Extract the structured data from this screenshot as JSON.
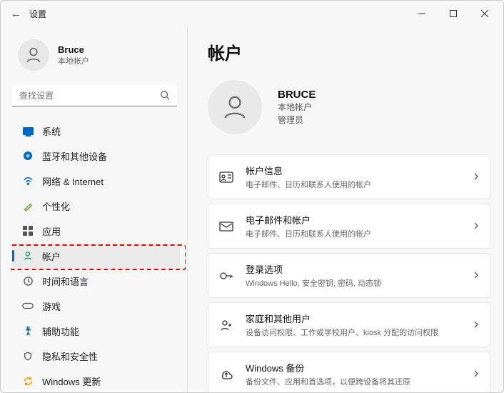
{
  "app_title": "设置",
  "user": {
    "name": "Bruce",
    "type": "本地帐户"
  },
  "search": {
    "placeholder": "查找设置"
  },
  "sidebar": {
    "items": [
      {
        "label": "系统"
      },
      {
        "label": "蓝牙和其他设备"
      },
      {
        "label": "网络 & Internet"
      },
      {
        "label": "个性化"
      },
      {
        "label": "应用"
      },
      {
        "label": "帐户"
      },
      {
        "label": "时间和语言"
      },
      {
        "label": "游戏"
      },
      {
        "label": "辅助功能"
      },
      {
        "label": "隐私和安全性"
      },
      {
        "label": "Windows 更新"
      }
    ],
    "selected_index": 5
  },
  "main": {
    "heading": "帐户",
    "account": {
      "display_name": "BRUCE",
      "type": "本地帐户",
      "role": "管理员"
    },
    "cards": [
      {
        "title": "帐户信息",
        "desc": "电子邮件、日历和联系人使用的帐户"
      },
      {
        "title": "电子邮件和帐户",
        "desc": "电子邮件、日历和联系人使用的帐户"
      },
      {
        "title": "登录选项",
        "desc": "Windows Hello, 安全密钥, 密码, 动态锁"
      },
      {
        "title": "家庭和其他用户",
        "desc": "设备访问权限、工作或学校用户、kiosk 分配的访问权限"
      },
      {
        "title": "Windows 备份",
        "desc": "备份文件、应用和首选项，以便跨设备将其还原"
      }
    ]
  }
}
